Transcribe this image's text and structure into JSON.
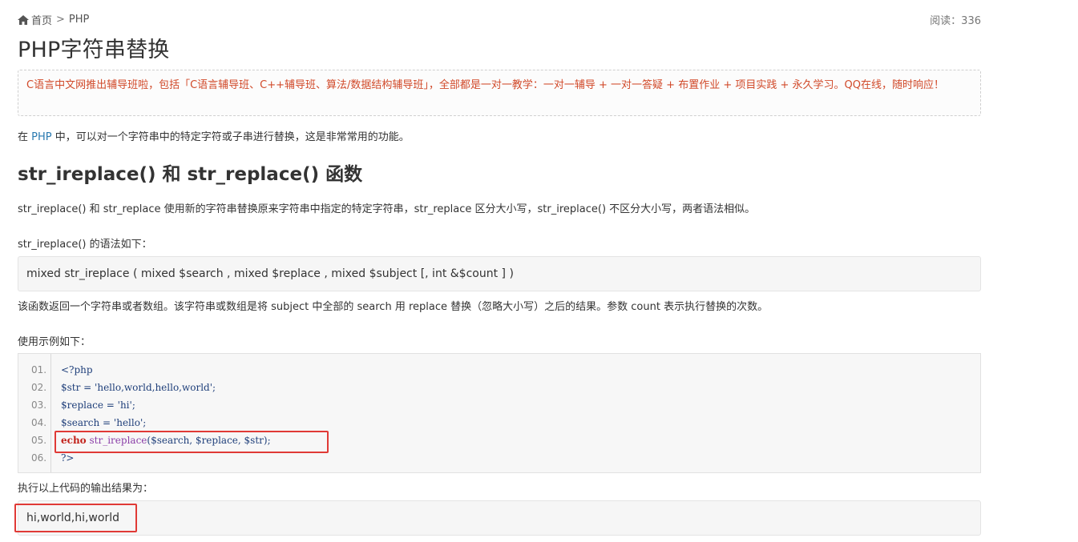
{
  "breadcrumb": {
    "home": "首页",
    "separator": ">",
    "section": "PHP"
  },
  "reads": {
    "label": "阅读：",
    "count": "336"
  },
  "page_title": "PHP字符串替换",
  "notice": "C语言中文网推出辅导班啦，包括「C语言辅导班、C++辅导班、算法/数据结构辅导班」，全部都是一对一教学：一对一辅导 + 一对一答疑 + 布置作业 + 项目实践 + 永久学习。QQ在线，随时响应！",
  "intro": {
    "before": "在 ",
    "link": "PHP",
    "after": " 中，可以对一个字符串中的特定字符或子串进行替换，这是非常常用的功能。"
  },
  "section_heading": "str_ireplace() 和 str_replace() 函数",
  "para_desc": "str_ireplace() 和 str_replace 使用新的字符串替换原来字符串中指定的特定字符串，str_replace 区分大小写，str_ireplace() 不区分大小写，两者语法相似。",
  "syntax_label": "str_ireplace() 的语法如下：",
  "syntax_code": "mixed str_ireplace ( mixed $search , mixed $replace , mixed $subject [, int &$count ] )",
  "para_return": "该函数返回一个字符串或者数组。该字符串或数组是将 subject 中全部的 search 用 replace 替换（忽略大小写）之后的结果。参数 count 表示执行替换的次数。",
  "example_label": "使用示例如下：",
  "code_lines": [
    {
      "num": "01.",
      "text": "<?php"
    },
    {
      "num": "02.",
      "text": "$str = 'hello,world,hello,world';"
    },
    {
      "num": "03.",
      "text": "$replace = 'hi';"
    },
    {
      "num": "04.",
      "text": "$search = 'hello';"
    },
    {
      "num": "05.",
      "kw": "echo",
      "fn": "str_ireplace",
      "rest": "($search, $replace, $str);"
    },
    {
      "num": "06.",
      "text": "?>"
    }
  ],
  "output_label": "执行以上代码的输出结果为：",
  "output_value": "hi,world,hi,world",
  "colors": {
    "highlight_border": "#e03a36",
    "notice_text": "#d14a2a",
    "link": "#2a7ab0"
  }
}
